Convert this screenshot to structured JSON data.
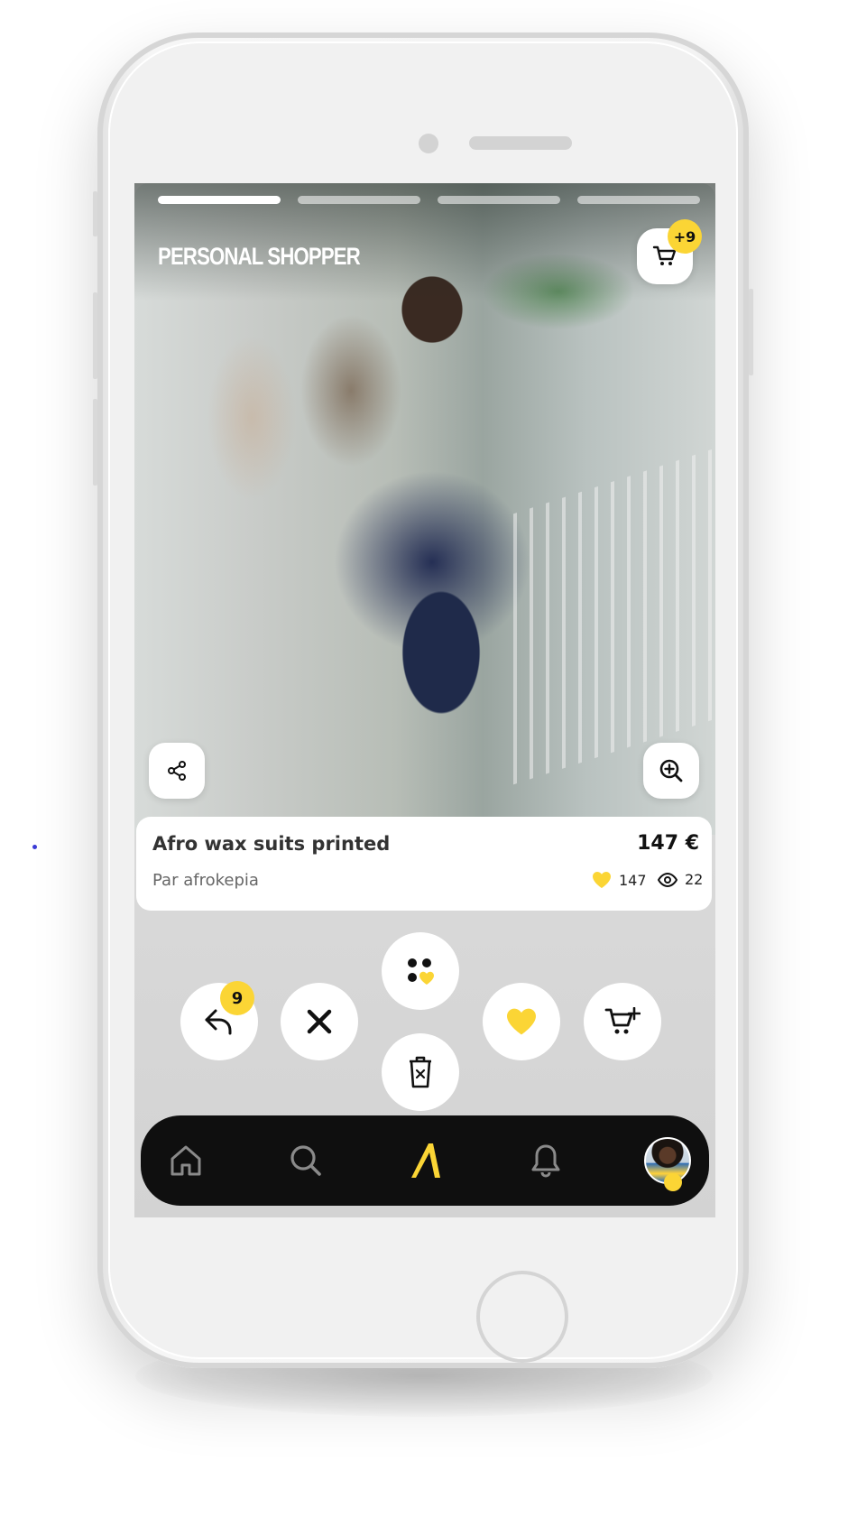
{
  "colors": {
    "accent_yellow": "#fbd535",
    "navbar_bg": "#0f0f0f",
    "card_bg": "#ffffff",
    "phone_body": "#f1f1f1"
  },
  "story": {
    "title": "PERSONAL SHOPPER",
    "progress_segments": 4,
    "active_segment": 1,
    "cart_badge": "+9",
    "share_icon": "share-icon",
    "zoom_icon": "zoom-in-icon"
  },
  "product": {
    "name": "Afro wax suits printed",
    "price": "147 €",
    "seller": "Par afrokepia",
    "likes": "147",
    "views": "22"
  },
  "actions": {
    "undo_badge": "9",
    "buttons": [
      "undo-icon",
      "close-icon",
      "style-match-icon",
      "trash-icon",
      "heart-icon",
      "add-to-cart-icon"
    ]
  },
  "navbar": {
    "items": [
      "home-icon",
      "search-icon",
      "brand-logo-icon",
      "bell-icon",
      "avatar"
    ]
  }
}
